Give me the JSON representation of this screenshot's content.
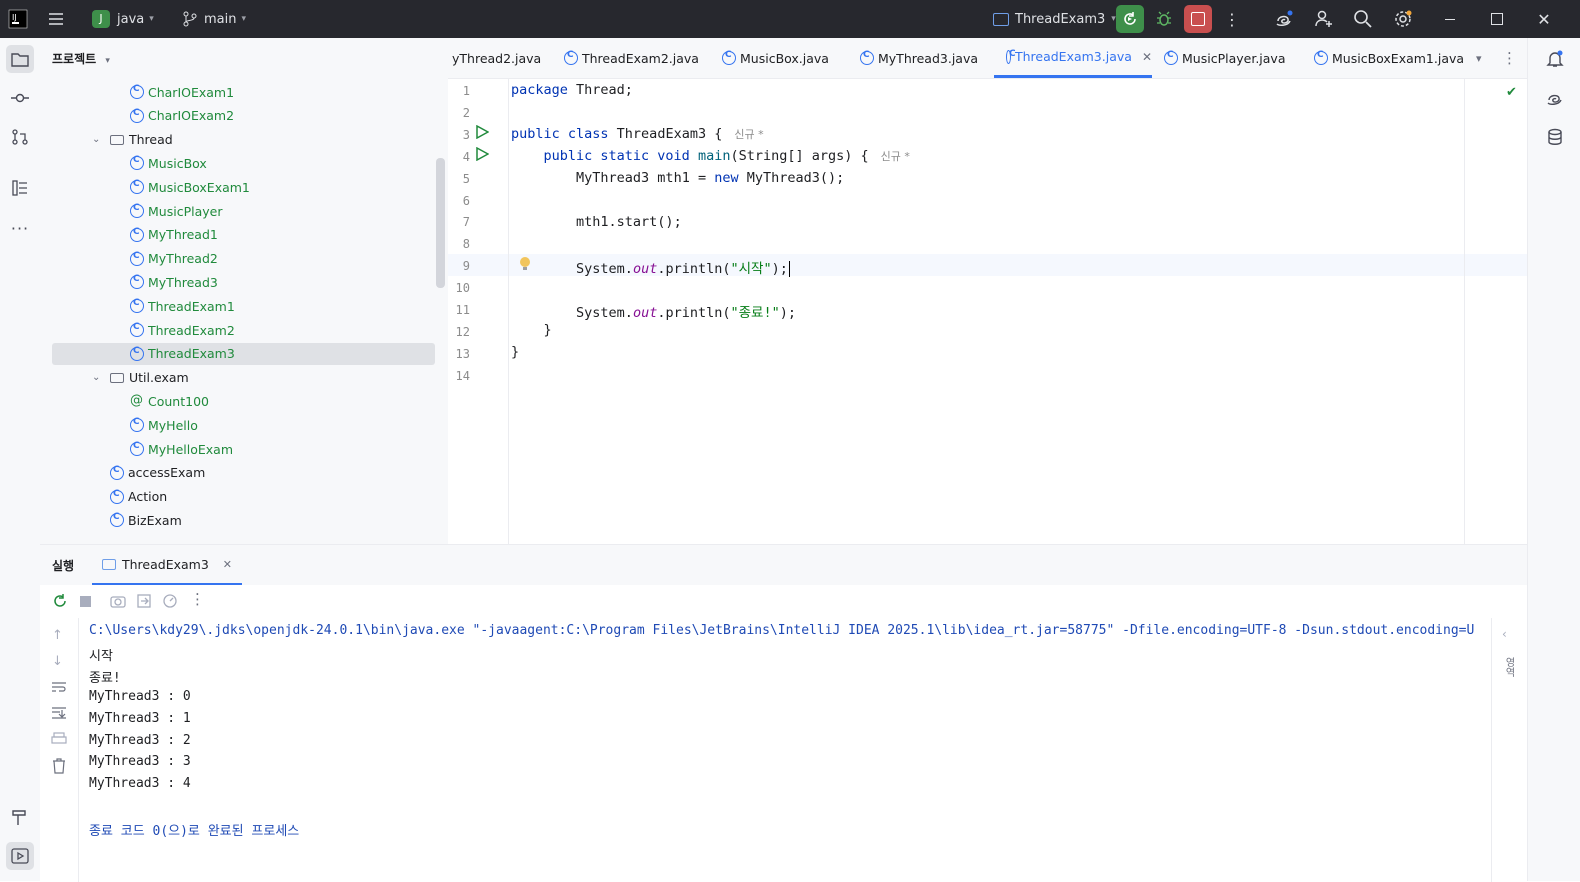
{
  "titlebar": {
    "project_letter": "J",
    "project_name": "java",
    "branch": "main",
    "run_config": "ThreadExam3",
    "colors": {
      "bg": "#27282e",
      "run_green": "#3e8f4a",
      "stop_red": "#c94f4f"
    }
  },
  "project": {
    "title": "프로젝트",
    "items": [
      {
        "label": "CharIOExam1",
        "kind": "class-run"
      },
      {
        "label": "CharIOExam2",
        "kind": "class-run"
      },
      {
        "label": "Thread",
        "kind": "package"
      },
      {
        "label": "MusicBox",
        "kind": "class"
      },
      {
        "label": "MusicBoxExam1",
        "kind": "class-run"
      },
      {
        "label": "MusicPlayer",
        "kind": "class"
      },
      {
        "label": "MyThread1",
        "kind": "class"
      },
      {
        "label": "MyThread2",
        "kind": "class"
      },
      {
        "label": "MyThread3",
        "kind": "class"
      },
      {
        "label": "ThreadExam1",
        "kind": "class-run"
      },
      {
        "label": "ThreadExam2",
        "kind": "class-run"
      },
      {
        "label": "ThreadExam3",
        "kind": "class-run"
      },
      {
        "label": "Util.exam",
        "kind": "package"
      },
      {
        "label": "Count100",
        "kind": "annotation"
      },
      {
        "label": "MyHello",
        "kind": "class"
      },
      {
        "label": "MyHelloExam",
        "kind": "class-run"
      },
      {
        "label": "accessExam",
        "kind": "class-run"
      },
      {
        "label": "Action",
        "kind": "class"
      },
      {
        "label": "BizExam",
        "kind": "class-run"
      }
    ]
  },
  "tabs": [
    "yThread2.java",
    "ThreadExam2.java",
    "MusicBox.java",
    "MyThread3.java",
    "ThreadExam3.java",
    "MusicPlayer.java",
    "MusicBoxExam1.java"
  ],
  "editor": {
    "line_numbers": [
      "1",
      "2",
      "3",
      "4",
      "5",
      "6",
      "7",
      "8",
      "9",
      "10",
      "11",
      "12",
      "13",
      "14"
    ],
    "hint_new": "신규 *",
    "lines": {
      "l1_kw": "package",
      "l1_rest": " Thread;",
      "l3_kw": "public class",
      "l3_rest": " ThreadExam3 {",
      "l4_kw": "public static void",
      "l4_fn": "main",
      "l4_rest": "(String[] args) {",
      "l5_a": "MyThread3 mth1 = ",
      "l5_kw": "new",
      "l5_b": " MyThread3();",
      "l7": "mth1.start();",
      "l9_a": "System.",
      "l9_out": "out",
      "l9_b": ".println(",
      "l9_str": "\"시작\"",
      "l9_c": ");",
      "l11_a": "System.",
      "l11_out": "out",
      "l11_b": ".println(",
      "l11_str": "\"종료!\"",
      "l11_c": ");",
      "l12": "}",
      "l13": "}"
    }
  },
  "run": {
    "title": "실행",
    "tab": "ThreadExam3",
    "output": [
      "C:\\Users\\kdy29\\.jdks\\openjdk-24.0.1\\bin\\java.exe \"-javaagent:C:\\Program Files\\JetBrains\\IntelliJ IDEA 2025.1\\lib\\idea_rt.jar=58775\" -Dfile.encoding=UTF-8 -Dsun.stdout.encoding=U",
      "시작",
      "종료!",
      "MyThread3 : 0",
      "MyThread3 : 1",
      "MyThread3 : 2",
      "MyThread3 : 3",
      "MyThread3 : 4",
      "",
      "종료 코드 0(으)로 완료된 프로세스"
    ],
    "side_label": "영역"
  }
}
